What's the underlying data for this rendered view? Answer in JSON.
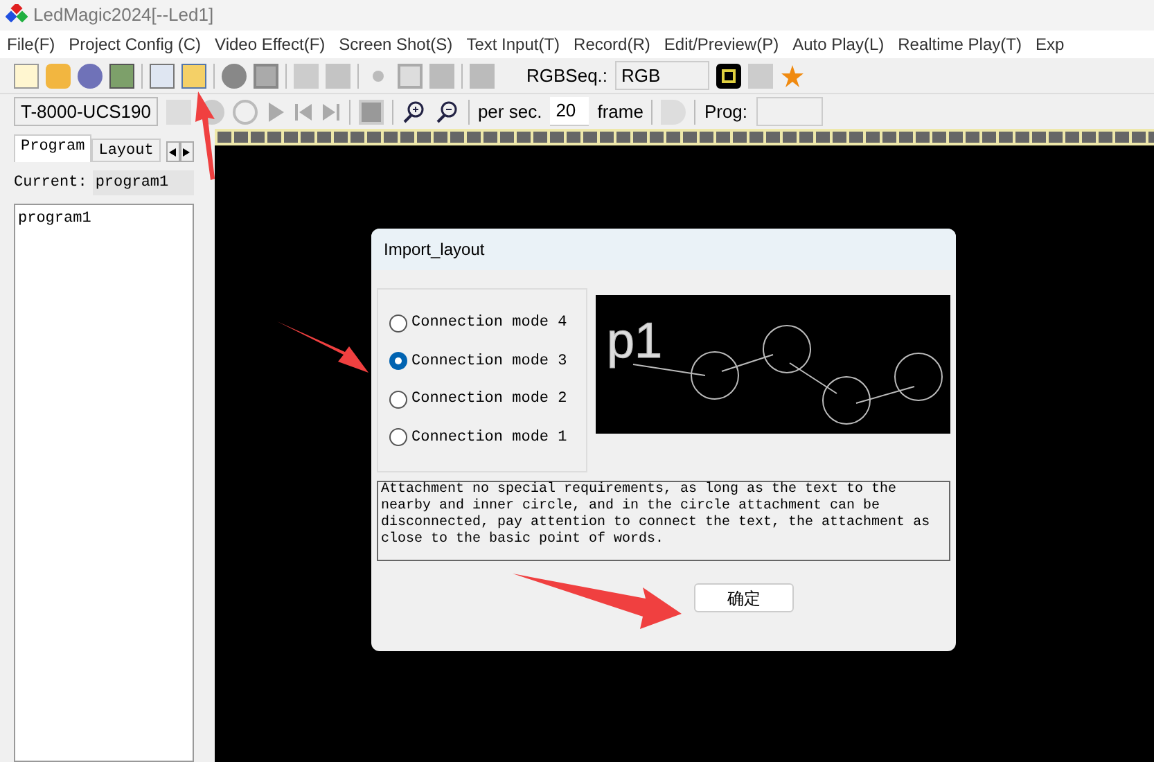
{
  "window": {
    "title": "LedMagic2024[--Led1]"
  },
  "menu": [
    "File(F)",
    "Project Config (C)",
    "Video Effect(F)",
    "Screen Shot(S)",
    "Text Input(T)",
    "Record(R)",
    "Edit/Preview(P)",
    "Auto Play(L)",
    "Realtime Play(T)",
    "Exp"
  ],
  "toolbar": {
    "rgb_label": "RGBSeq.:",
    "rgb_value": "RGB"
  },
  "toolbar2": {
    "controller": "T-8000-UCS190",
    "per_sec_label": "per sec.",
    "per_sec_value": "20",
    "frame_label": "frame",
    "prog_label": "Prog:"
  },
  "left_panel": {
    "tabs": [
      {
        "label": "Program",
        "selected": true
      },
      {
        "label": "Layout",
        "selected": false
      }
    ],
    "current_label": "Current:",
    "current_value": "program1",
    "programs": [
      "program1"
    ]
  },
  "dialog": {
    "title": "Import_layout",
    "modes": [
      {
        "label": "Connection mode 4",
        "selected": false
      },
      {
        "label": "Connection mode 3",
        "selected": true
      },
      {
        "label": "Connection mode 2",
        "selected": false
      },
      {
        "label": "Connection mode 1",
        "selected": false
      }
    ],
    "preview_label": "p1",
    "description": "Attachment no special requirements, as long as the text to the nearby and inner circle, and in the circle attachment can be disconnected, pay attention to connect the text, the attachment as close to the basic point of words.",
    "ok_button": "确定"
  }
}
